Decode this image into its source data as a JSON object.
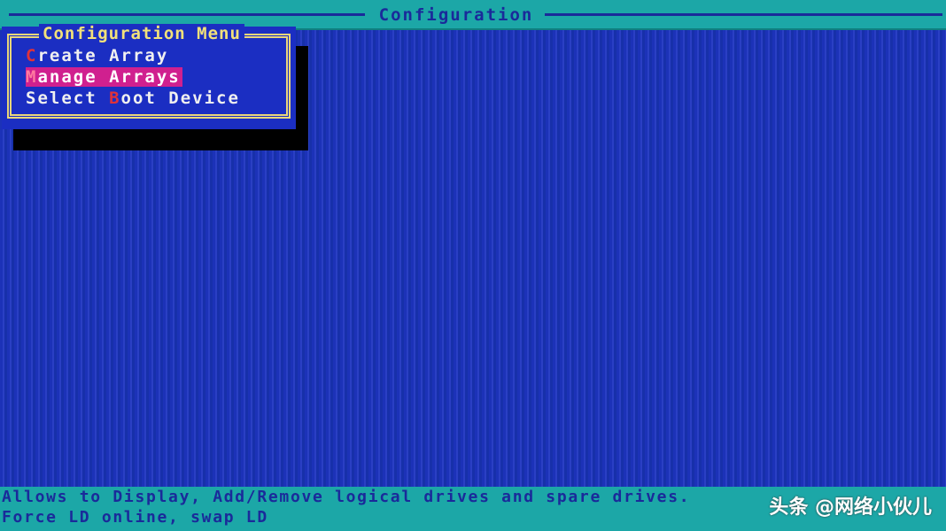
{
  "header": {
    "title": "Configuration"
  },
  "menu": {
    "title": "Configuration Menu",
    "items": [
      {
        "pre": "",
        "hot": "C",
        "post": "reate Array",
        "selected": false
      },
      {
        "pre": "",
        "hot": "M",
        "post": "anage Arrays",
        "selected": true
      },
      {
        "pre": "Select ",
        "hot": "B",
        "post": "oot Device",
        "selected": false
      }
    ]
  },
  "status": {
    "line1": "Allows to Display, Add/Remove logical drives and spare drives.",
    "line2": "Force LD online, swap LD"
  },
  "watermark": "头条 @网络小伙儿",
  "colors": {
    "background": "#1c32b8",
    "bar": "#1ca7a7",
    "highlight": "#d0208f",
    "hotkey": "#e0323a",
    "frame": "#e9d67a"
  }
}
